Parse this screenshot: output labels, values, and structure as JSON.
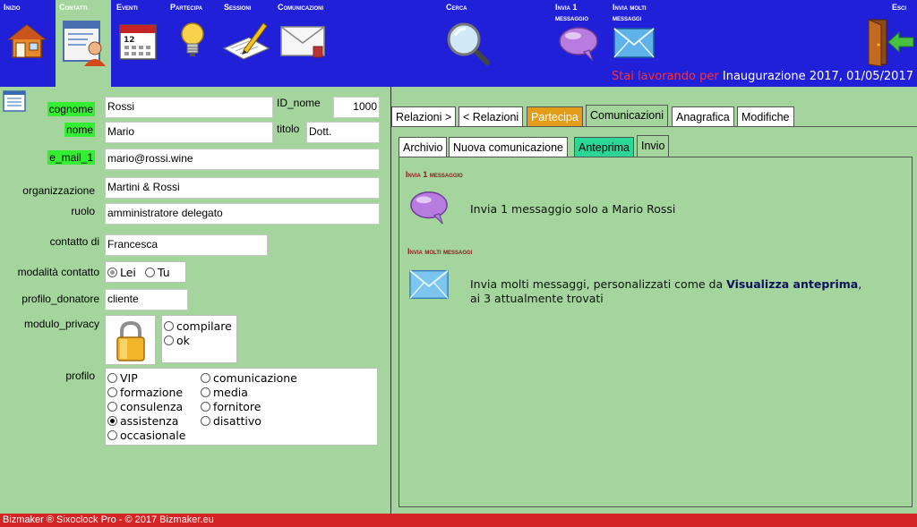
{
  "nav": {
    "inizio": "Inizio",
    "contatti": "Contatti",
    "eventi": "Eventi",
    "partecipa": "Partecipa",
    "sessioni": "Sessioni",
    "comunicazioni": "Comunicazioni",
    "cerca": "Cerca",
    "invia1_line1": "Invia 1",
    "invia1_line2": "messaggio",
    "inviamolti_line1": "Invia molti",
    "inviamolti_line2": "messaggi",
    "esci": "Esci"
  },
  "status": {
    "prefix": "Stai lavorando per",
    "value": "Inaugurazione 2017, 01/05/2017"
  },
  "form": {
    "cognome_label": "cognome",
    "cognome": "Rossi",
    "id_label": "ID_nome",
    "id_value": "1000",
    "nome_label": "nome",
    "nome": "Mario",
    "titolo_label": "titolo",
    "titolo": "Dott.",
    "email_label": "e_mail_1",
    "email": "mario@rossi.wine",
    "org_label": "organizzazione",
    "org": "Martini & Rossi",
    "ruolo_label": "ruolo",
    "ruolo": "amministratore delegato",
    "contatto_label": "contatto di",
    "contatto": "Francesca",
    "modalita_label": "modalità contatto",
    "modalita_options": [
      "Lei",
      "Tu"
    ],
    "modalita_selected": "Lei",
    "donatore_label": "profilo_donatore",
    "donatore": "cliente",
    "privacy_label": "modulo_privacy",
    "privacy_options": [
      "compilare",
      "ok"
    ],
    "profilo_label": "profilo",
    "profilo_col1": [
      "VIP",
      "formazione",
      "consulenza",
      "assistenza",
      "occasionale"
    ],
    "profilo_col2": [
      "comunicazione",
      "media",
      "fornitore",
      "disattivo"
    ],
    "profilo_selected": "assistenza"
  },
  "tabs_top": [
    "Relazioni >",
    "< Relazioni",
    "Partecipa",
    "Comunicazioni",
    "Anagrafica",
    "Modifiche"
  ],
  "tabs_sub": [
    "Archivio",
    "Nuova comunicazione",
    "Anteprima",
    "Invio"
  ],
  "invio": {
    "one_title": "Invia 1 messaggio",
    "one_text": "Invia 1 messaggio solo a Mario Rossi",
    "many_title": "Invia molti messaggi",
    "many_text_pre": "Invia molti messaggi, personalizzati come da",
    "many_text_bold": "Visualizza anteprima",
    "many_text_post": ",",
    "many_text_line2": "ai 3 attualmente trovati"
  },
  "footer": "Bizmaker ® Sixoclock Pro - © 2017 Bizmaker.eu",
  "colors": {
    "topbar": "#2020d8",
    "background": "#a3d59c",
    "highlight": "#33ee33",
    "orange_tab": "#e39d19",
    "teal_tab": "#2bd697",
    "footer": "#d42424"
  }
}
